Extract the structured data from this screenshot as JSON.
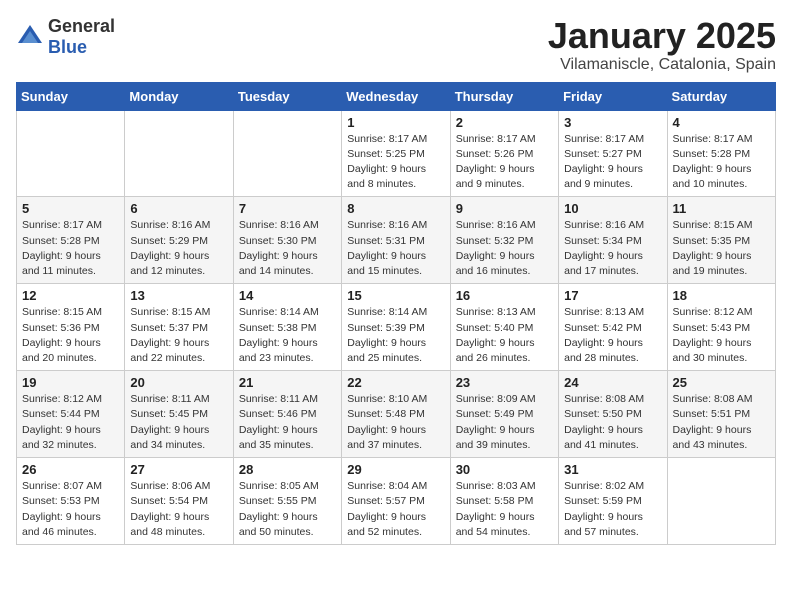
{
  "logo": {
    "text_general": "General",
    "text_blue": "Blue"
  },
  "title": "January 2025",
  "location": "Vilamaniscle, Catalonia, Spain",
  "days_of_week": [
    "Sunday",
    "Monday",
    "Tuesday",
    "Wednesday",
    "Thursday",
    "Friday",
    "Saturday"
  ],
  "weeks": [
    [
      {
        "day": "",
        "info": ""
      },
      {
        "day": "",
        "info": ""
      },
      {
        "day": "",
        "info": ""
      },
      {
        "day": "1",
        "info": "Sunrise: 8:17 AM\nSunset: 5:25 PM\nDaylight: 9 hours\nand 8 minutes."
      },
      {
        "day": "2",
        "info": "Sunrise: 8:17 AM\nSunset: 5:26 PM\nDaylight: 9 hours\nand 9 minutes."
      },
      {
        "day": "3",
        "info": "Sunrise: 8:17 AM\nSunset: 5:27 PM\nDaylight: 9 hours\nand 9 minutes."
      },
      {
        "day": "4",
        "info": "Sunrise: 8:17 AM\nSunset: 5:28 PM\nDaylight: 9 hours\nand 10 minutes."
      }
    ],
    [
      {
        "day": "5",
        "info": "Sunrise: 8:17 AM\nSunset: 5:28 PM\nDaylight: 9 hours\nand 11 minutes."
      },
      {
        "day": "6",
        "info": "Sunrise: 8:16 AM\nSunset: 5:29 PM\nDaylight: 9 hours\nand 12 minutes."
      },
      {
        "day": "7",
        "info": "Sunrise: 8:16 AM\nSunset: 5:30 PM\nDaylight: 9 hours\nand 14 minutes."
      },
      {
        "day": "8",
        "info": "Sunrise: 8:16 AM\nSunset: 5:31 PM\nDaylight: 9 hours\nand 15 minutes."
      },
      {
        "day": "9",
        "info": "Sunrise: 8:16 AM\nSunset: 5:32 PM\nDaylight: 9 hours\nand 16 minutes."
      },
      {
        "day": "10",
        "info": "Sunrise: 8:16 AM\nSunset: 5:34 PM\nDaylight: 9 hours\nand 17 minutes."
      },
      {
        "day": "11",
        "info": "Sunrise: 8:15 AM\nSunset: 5:35 PM\nDaylight: 9 hours\nand 19 minutes."
      }
    ],
    [
      {
        "day": "12",
        "info": "Sunrise: 8:15 AM\nSunset: 5:36 PM\nDaylight: 9 hours\nand 20 minutes."
      },
      {
        "day": "13",
        "info": "Sunrise: 8:15 AM\nSunset: 5:37 PM\nDaylight: 9 hours\nand 22 minutes."
      },
      {
        "day": "14",
        "info": "Sunrise: 8:14 AM\nSunset: 5:38 PM\nDaylight: 9 hours\nand 23 minutes."
      },
      {
        "day": "15",
        "info": "Sunrise: 8:14 AM\nSunset: 5:39 PM\nDaylight: 9 hours\nand 25 minutes."
      },
      {
        "day": "16",
        "info": "Sunrise: 8:13 AM\nSunset: 5:40 PM\nDaylight: 9 hours\nand 26 minutes."
      },
      {
        "day": "17",
        "info": "Sunrise: 8:13 AM\nSunset: 5:42 PM\nDaylight: 9 hours\nand 28 minutes."
      },
      {
        "day": "18",
        "info": "Sunrise: 8:12 AM\nSunset: 5:43 PM\nDaylight: 9 hours\nand 30 minutes."
      }
    ],
    [
      {
        "day": "19",
        "info": "Sunrise: 8:12 AM\nSunset: 5:44 PM\nDaylight: 9 hours\nand 32 minutes."
      },
      {
        "day": "20",
        "info": "Sunrise: 8:11 AM\nSunset: 5:45 PM\nDaylight: 9 hours\nand 34 minutes."
      },
      {
        "day": "21",
        "info": "Sunrise: 8:11 AM\nSunset: 5:46 PM\nDaylight: 9 hours\nand 35 minutes."
      },
      {
        "day": "22",
        "info": "Sunrise: 8:10 AM\nSunset: 5:48 PM\nDaylight: 9 hours\nand 37 minutes."
      },
      {
        "day": "23",
        "info": "Sunrise: 8:09 AM\nSunset: 5:49 PM\nDaylight: 9 hours\nand 39 minutes."
      },
      {
        "day": "24",
        "info": "Sunrise: 8:08 AM\nSunset: 5:50 PM\nDaylight: 9 hours\nand 41 minutes."
      },
      {
        "day": "25",
        "info": "Sunrise: 8:08 AM\nSunset: 5:51 PM\nDaylight: 9 hours\nand 43 minutes."
      }
    ],
    [
      {
        "day": "26",
        "info": "Sunrise: 8:07 AM\nSunset: 5:53 PM\nDaylight: 9 hours\nand 46 minutes."
      },
      {
        "day": "27",
        "info": "Sunrise: 8:06 AM\nSunset: 5:54 PM\nDaylight: 9 hours\nand 48 minutes."
      },
      {
        "day": "28",
        "info": "Sunrise: 8:05 AM\nSunset: 5:55 PM\nDaylight: 9 hours\nand 50 minutes."
      },
      {
        "day": "29",
        "info": "Sunrise: 8:04 AM\nSunset: 5:57 PM\nDaylight: 9 hours\nand 52 minutes."
      },
      {
        "day": "30",
        "info": "Sunrise: 8:03 AM\nSunset: 5:58 PM\nDaylight: 9 hours\nand 54 minutes."
      },
      {
        "day": "31",
        "info": "Sunrise: 8:02 AM\nSunset: 5:59 PM\nDaylight: 9 hours\nand 57 minutes."
      },
      {
        "day": "",
        "info": ""
      }
    ]
  ]
}
